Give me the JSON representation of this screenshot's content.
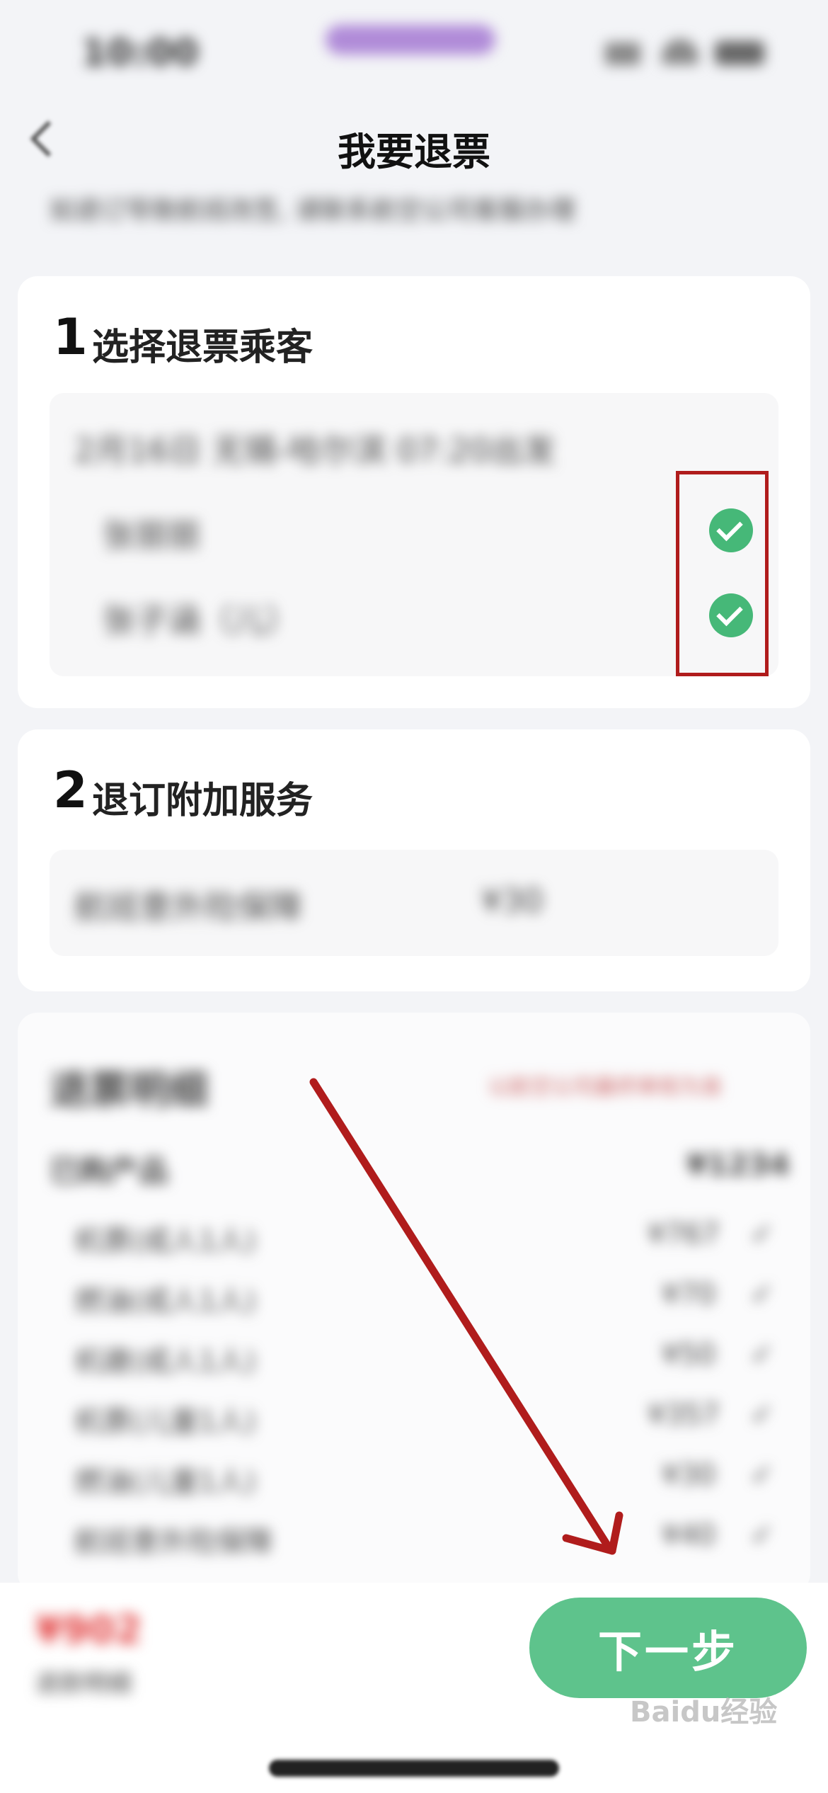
{
  "status": {
    "time": "10:00"
  },
  "header": {
    "title": "我要退票",
    "notice": "如退订导致航班改签, 请联系航空公司客服办理"
  },
  "section1": {
    "number": "1",
    "title": "选择退票乘客",
    "trip": "2月16日 无锡-哈尔滨 07:20出发",
    "passengers": [
      {
        "name": "张丽丽",
        "selected": true
      },
      {
        "name": "张子涵（儿）",
        "selected": true
      }
    ]
  },
  "section2": {
    "number": "2",
    "title": "退订附加服务",
    "addon": "航班意外险保障",
    "addon_price": "¥30"
  },
  "refund": {
    "title": "退票明细",
    "note": "以航空公司最终审核为准",
    "header_left": "已购产品",
    "header_right": "¥1234",
    "rows": [
      {
        "label": "机票(成人1人)",
        "price": "¥767"
      },
      {
        "label": "燃油(成人1人)",
        "price": "¥70"
      },
      {
        "label": "机建(成人1人)",
        "price": "¥50"
      },
      {
        "label": "机票(儿童1人)",
        "price": "¥357"
      },
      {
        "label": "燃油(儿童1人)",
        "price": "¥30"
      },
      {
        "label": "航班意外险保障",
        "price": "¥40"
      }
    ]
  },
  "footer": {
    "total": "¥902",
    "detail": "退款明细",
    "next_label": "下一步"
  },
  "colors": {
    "accent_green": "#5ec38c",
    "check_green": "#46b878",
    "highlight_red": "#b01c1c",
    "price_red": "#e24444"
  },
  "watermark": "Baidu经验"
}
